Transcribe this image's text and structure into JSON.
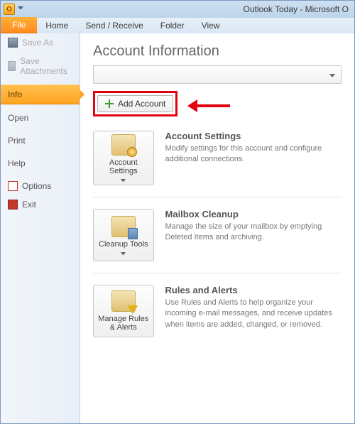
{
  "window": {
    "title": "Outlook Today - Microsoft O"
  },
  "ribbon": {
    "tabs": {
      "file": "File",
      "home": "Home",
      "send_receive": "Send / Receive",
      "folder": "Folder",
      "view": "View"
    }
  },
  "sidebar": {
    "save_as": "Save As",
    "save_attachments": "Save Attachments",
    "info": "Info",
    "open": "Open",
    "print": "Print",
    "help": "Help",
    "options": "Options",
    "exit": "Exit"
  },
  "page": {
    "title": "Account Information",
    "add_account": "Add Account"
  },
  "sections": {
    "account_settings": {
      "button": "Account Settings",
      "heading": "Account Settings",
      "desc": "Modify settings for this account and configure additional connections."
    },
    "mailbox_cleanup": {
      "button": "Cleanup Tools",
      "heading": "Mailbox Cleanup",
      "desc": "Manage the size of your mailbox by emptying Deleted Items and archiving."
    },
    "rules_alerts": {
      "button": "Manage Rules & Alerts",
      "heading": "Rules and Alerts",
      "desc": "Use Rules and Alerts to help organize your incoming e-mail messages, and receive updates when items are added, changed, or removed."
    }
  }
}
